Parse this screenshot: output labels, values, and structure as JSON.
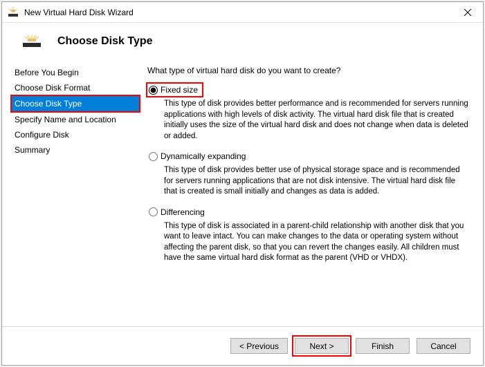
{
  "window": {
    "title": "New Virtual Hard Disk Wizard"
  },
  "header": {
    "title": "Choose Disk Type"
  },
  "sidebar": {
    "steps": [
      {
        "label": "Before You Begin"
      },
      {
        "label": "Choose Disk Format"
      },
      {
        "label": "Choose Disk Type"
      },
      {
        "label": "Specify Name and Location"
      },
      {
        "label": "Configure Disk"
      },
      {
        "label": "Summary"
      }
    ],
    "active_index": 2
  },
  "content": {
    "question": "What type of virtual hard disk do you want to create?",
    "options": [
      {
        "label": "Fixed size",
        "description": "This type of disk provides better performance and is recommended for servers running applications with high levels of disk activity. The virtual hard disk file that is created initially uses the size of the virtual hard disk and does not change when data is deleted or added."
      },
      {
        "label": "Dynamically expanding",
        "description": "This type of disk provides better use of physical storage space and is recommended for servers running applications that are not disk intensive. The virtual hard disk file that is created is small initially and changes as data is added."
      },
      {
        "label": "Differencing",
        "description": "This type of disk is associated in a parent-child relationship with another disk that you want to leave intact. You can make changes to the data or operating system without affecting the parent disk, so that you can revert the changes easily. All children must have the same virtual hard disk format as the parent (VHD or VHDX)."
      }
    ],
    "selected_index": 0
  },
  "footer": {
    "previous": "< Previous",
    "next": "Next >",
    "finish": "Finish",
    "cancel": "Cancel"
  }
}
